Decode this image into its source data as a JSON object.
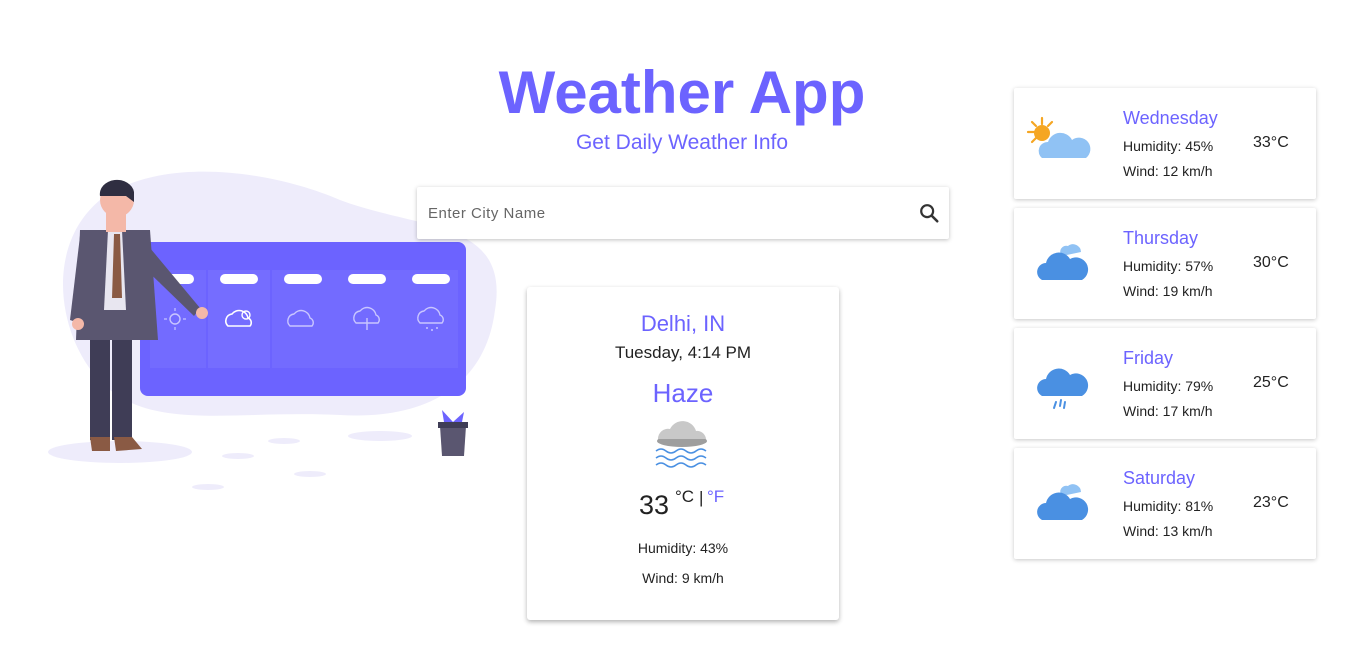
{
  "header": {
    "title": "Weather App",
    "subtitle": "Get Daily Weather Info"
  },
  "search": {
    "placeholder": "Enter City Name",
    "value": "",
    "icon": "search-icon"
  },
  "current": {
    "city": "Delhi, IN",
    "datetime": "Tuesday, 4:14 PM",
    "condition": "Haze",
    "icon": "haze-icon",
    "temperature": "33",
    "unit_c": "°C",
    "separator": "|",
    "unit_f": "°F",
    "humidity": "Humidity: 43%",
    "wind": "Wind: 9 km/h"
  },
  "forecast": [
    {
      "day": "Wednesday",
      "humidity": "Humidity: 45%",
      "wind": "Wind: 12 km/h",
      "temp": "33°C",
      "icon": "partly-sunny-icon"
    },
    {
      "day": "Thursday",
      "humidity": "Humidity: 57%",
      "wind": "Wind: 19 km/h",
      "temp": "30°C",
      "icon": "cloudy-icon"
    },
    {
      "day": "Friday",
      "humidity": "Humidity: 79%",
      "wind": "Wind: 17 km/h",
      "temp": "25°C",
      "icon": "rain-icon"
    },
    {
      "day": "Saturday",
      "humidity": "Humidity: 81%",
      "wind": "Wind: 13 km/h",
      "temp": "23°C",
      "icon": "cloudy-icon"
    }
  ],
  "colors": {
    "accent": "#6c63ff",
    "cloud": "#4a90e2",
    "sun": "#f5a623"
  }
}
